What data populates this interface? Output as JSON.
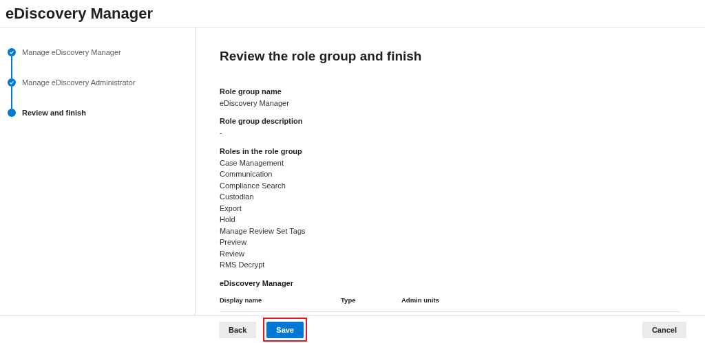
{
  "header": {
    "title": "eDiscovery Manager"
  },
  "steps": [
    {
      "label": "Manage eDiscovery Manager",
      "completed": true,
      "selected": false
    },
    {
      "label": "Manage eDiscovery Administrator",
      "completed": true,
      "selected": false
    },
    {
      "label": "Review and finish",
      "completed": false,
      "selected": true
    }
  ],
  "main": {
    "heading": "Review the role group and finish",
    "fields": [
      {
        "label": "Role group name",
        "values": [
          "eDiscovery Manager"
        ]
      },
      {
        "label": "Role group description",
        "values": [
          "-"
        ]
      },
      {
        "label": "Roles in the role group",
        "values": [
          "Case Management",
          "Communication",
          "Compliance Search",
          "Custodian",
          "Export",
          "Hold",
          "Manage Review Set Tags",
          "Preview",
          "Review",
          "RMS Decrypt"
        ]
      }
    ],
    "members": {
      "title": "eDiscovery Manager",
      "columns": [
        "Display name",
        "Type",
        "Admin units"
      ]
    }
  },
  "footer": {
    "buttons": [
      {
        "label": "Back",
        "kind": "secondary",
        "highlighted": false
      },
      {
        "label": "Save",
        "kind": "primary",
        "highlighted": true
      },
      {
        "label": "Cancel",
        "kind": "secondary",
        "highlighted": false
      }
    ]
  }
}
